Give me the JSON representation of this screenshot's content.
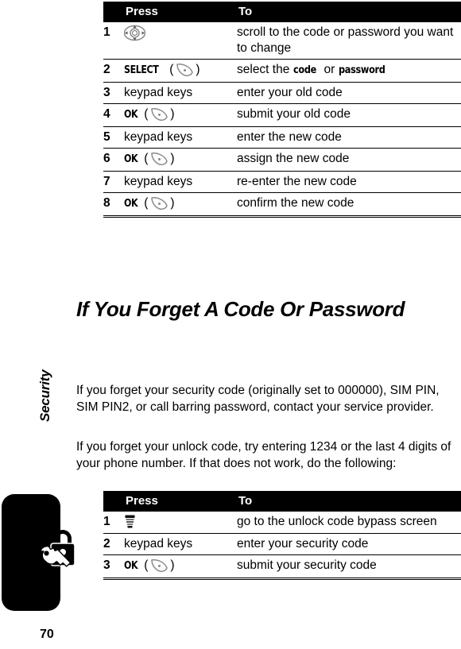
{
  "page": {
    "number": "70",
    "side_tab_label": "Security",
    "side_tab_icon": "padlock-key-icon"
  },
  "table_one": {
    "headers": {
      "num": "",
      "press": "Press",
      "to": "To"
    },
    "rows": [
      {
        "num": "1",
        "press_icon": "navigation-key-icon",
        "press": "",
        "to": "scroll to the code or password you want to change"
      },
      {
        "num": "2",
        "press": "SELECT",
        "press_icon": "soft-key-icon",
        "to_prefix": "select the ",
        "to_emph1": "code",
        "to_mid": " or ",
        "to_emph2": "password"
      },
      {
        "num": "3",
        "press": "keypad keys",
        "to": "enter your old code"
      },
      {
        "num": "4",
        "press": "OK",
        "press_icon": "soft-key-icon",
        "to": "submit your old code"
      },
      {
        "num": "5",
        "press": "keypad keys",
        "to": "enter the new code"
      },
      {
        "num": "6",
        "press": "OK",
        "press_icon": "soft-key-icon",
        "to": "assign the new code"
      },
      {
        "num": "7",
        "press": "keypad keys",
        "to": "re-enter the new code"
      },
      {
        "num": "8",
        "press": "OK",
        "press_icon": "soft-key-icon",
        "to": "confirm the new code"
      }
    ]
  },
  "heading": "If You Forget A Code Or Password",
  "paragraphs": {
    "p1": "If you forget your security code (originally set to 000000), SIM PIN, SIM PIN2, or call barring password, contact your service provider.",
    "p2": "If you forget your unlock code, try entering 1234 or the last 4 digits of your phone number. If that does not work, do the following:"
  },
  "table_two": {
    "headers": {
      "num": "",
      "press": "Press",
      "to": "To"
    },
    "rows": [
      {
        "num": "1",
        "press_icon": "menu-key-icon",
        "press": "",
        "to": "go to the unlock code bypass screen"
      },
      {
        "num": "2",
        "press": "keypad keys",
        "to": "enter your security code"
      },
      {
        "num": "3",
        "press": "OK",
        "press_icon": "soft-key-icon",
        "to": "submit your security code"
      }
    ]
  },
  "colors": {
    "header_bar": "#000000",
    "header_text": "#ffffff",
    "rule": "#000000",
    "icon_outline": "#8a8a8a"
  }
}
